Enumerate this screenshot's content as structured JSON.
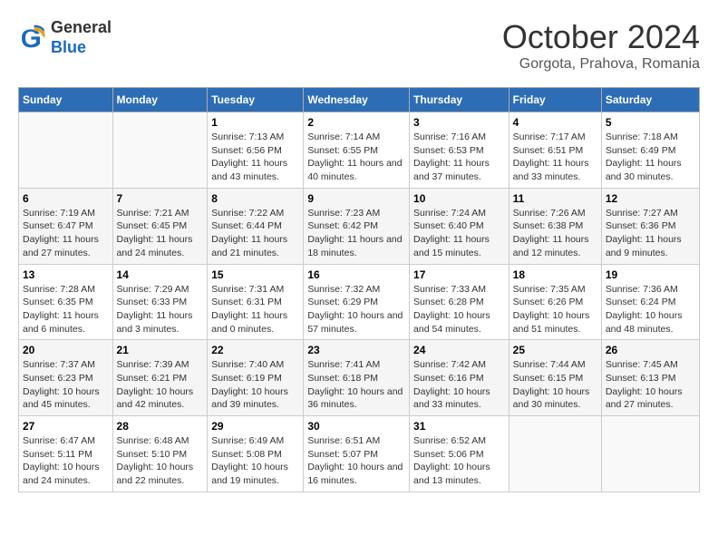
{
  "header": {
    "logo_line1": "General",
    "logo_line2": "Blue",
    "title": "October 2024",
    "subtitle": "Gorgota, Prahova, Romania"
  },
  "days_of_week": [
    "Sunday",
    "Monday",
    "Tuesday",
    "Wednesday",
    "Thursday",
    "Friday",
    "Saturday"
  ],
  "weeks": [
    [
      {
        "day": "",
        "info": ""
      },
      {
        "day": "",
        "info": ""
      },
      {
        "day": "1",
        "info": "Sunrise: 7:13 AM\nSunset: 6:56 PM\nDaylight: 11 hours and 43 minutes."
      },
      {
        "day": "2",
        "info": "Sunrise: 7:14 AM\nSunset: 6:55 PM\nDaylight: 11 hours and 40 minutes."
      },
      {
        "day": "3",
        "info": "Sunrise: 7:16 AM\nSunset: 6:53 PM\nDaylight: 11 hours and 37 minutes."
      },
      {
        "day": "4",
        "info": "Sunrise: 7:17 AM\nSunset: 6:51 PM\nDaylight: 11 hours and 33 minutes."
      },
      {
        "day": "5",
        "info": "Sunrise: 7:18 AM\nSunset: 6:49 PM\nDaylight: 11 hours and 30 minutes."
      }
    ],
    [
      {
        "day": "6",
        "info": "Sunrise: 7:19 AM\nSunset: 6:47 PM\nDaylight: 11 hours and 27 minutes."
      },
      {
        "day": "7",
        "info": "Sunrise: 7:21 AM\nSunset: 6:45 PM\nDaylight: 11 hours and 24 minutes."
      },
      {
        "day": "8",
        "info": "Sunrise: 7:22 AM\nSunset: 6:44 PM\nDaylight: 11 hours and 21 minutes."
      },
      {
        "day": "9",
        "info": "Sunrise: 7:23 AM\nSunset: 6:42 PM\nDaylight: 11 hours and 18 minutes."
      },
      {
        "day": "10",
        "info": "Sunrise: 7:24 AM\nSunset: 6:40 PM\nDaylight: 11 hours and 15 minutes."
      },
      {
        "day": "11",
        "info": "Sunrise: 7:26 AM\nSunset: 6:38 PM\nDaylight: 11 hours and 12 minutes."
      },
      {
        "day": "12",
        "info": "Sunrise: 7:27 AM\nSunset: 6:36 PM\nDaylight: 11 hours and 9 minutes."
      }
    ],
    [
      {
        "day": "13",
        "info": "Sunrise: 7:28 AM\nSunset: 6:35 PM\nDaylight: 11 hours and 6 minutes."
      },
      {
        "day": "14",
        "info": "Sunrise: 7:29 AM\nSunset: 6:33 PM\nDaylight: 11 hours and 3 minutes."
      },
      {
        "day": "15",
        "info": "Sunrise: 7:31 AM\nSunset: 6:31 PM\nDaylight: 11 hours and 0 minutes."
      },
      {
        "day": "16",
        "info": "Sunrise: 7:32 AM\nSunset: 6:29 PM\nDaylight: 10 hours and 57 minutes."
      },
      {
        "day": "17",
        "info": "Sunrise: 7:33 AM\nSunset: 6:28 PM\nDaylight: 10 hours and 54 minutes."
      },
      {
        "day": "18",
        "info": "Sunrise: 7:35 AM\nSunset: 6:26 PM\nDaylight: 10 hours and 51 minutes."
      },
      {
        "day": "19",
        "info": "Sunrise: 7:36 AM\nSunset: 6:24 PM\nDaylight: 10 hours and 48 minutes."
      }
    ],
    [
      {
        "day": "20",
        "info": "Sunrise: 7:37 AM\nSunset: 6:23 PM\nDaylight: 10 hours and 45 minutes."
      },
      {
        "day": "21",
        "info": "Sunrise: 7:39 AM\nSunset: 6:21 PM\nDaylight: 10 hours and 42 minutes."
      },
      {
        "day": "22",
        "info": "Sunrise: 7:40 AM\nSunset: 6:19 PM\nDaylight: 10 hours and 39 minutes."
      },
      {
        "day": "23",
        "info": "Sunrise: 7:41 AM\nSunset: 6:18 PM\nDaylight: 10 hours and 36 minutes."
      },
      {
        "day": "24",
        "info": "Sunrise: 7:42 AM\nSunset: 6:16 PM\nDaylight: 10 hours and 33 minutes."
      },
      {
        "day": "25",
        "info": "Sunrise: 7:44 AM\nSunset: 6:15 PM\nDaylight: 10 hours and 30 minutes."
      },
      {
        "day": "26",
        "info": "Sunrise: 7:45 AM\nSunset: 6:13 PM\nDaylight: 10 hours and 27 minutes."
      }
    ],
    [
      {
        "day": "27",
        "info": "Sunrise: 6:47 AM\nSunset: 5:11 PM\nDaylight: 10 hours and 24 minutes."
      },
      {
        "day": "28",
        "info": "Sunrise: 6:48 AM\nSunset: 5:10 PM\nDaylight: 10 hours and 22 minutes."
      },
      {
        "day": "29",
        "info": "Sunrise: 6:49 AM\nSunset: 5:08 PM\nDaylight: 10 hours and 19 minutes."
      },
      {
        "day": "30",
        "info": "Sunrise: 6:51 AM\nSunset: 5:07 PM\nDaylight: 10 hours and 16 minutes."
      },
      {
        "day": "31",
        "info": "Sunrise: 6:52 AM\nSunset: 5:06 PM\nDaylight: 10 hours and 13 minutes."
      },
      {
        "day": "",
        "info": ""
      },
      {
        "day": "",
        "info": ""
      }
    ]
  ]
}
